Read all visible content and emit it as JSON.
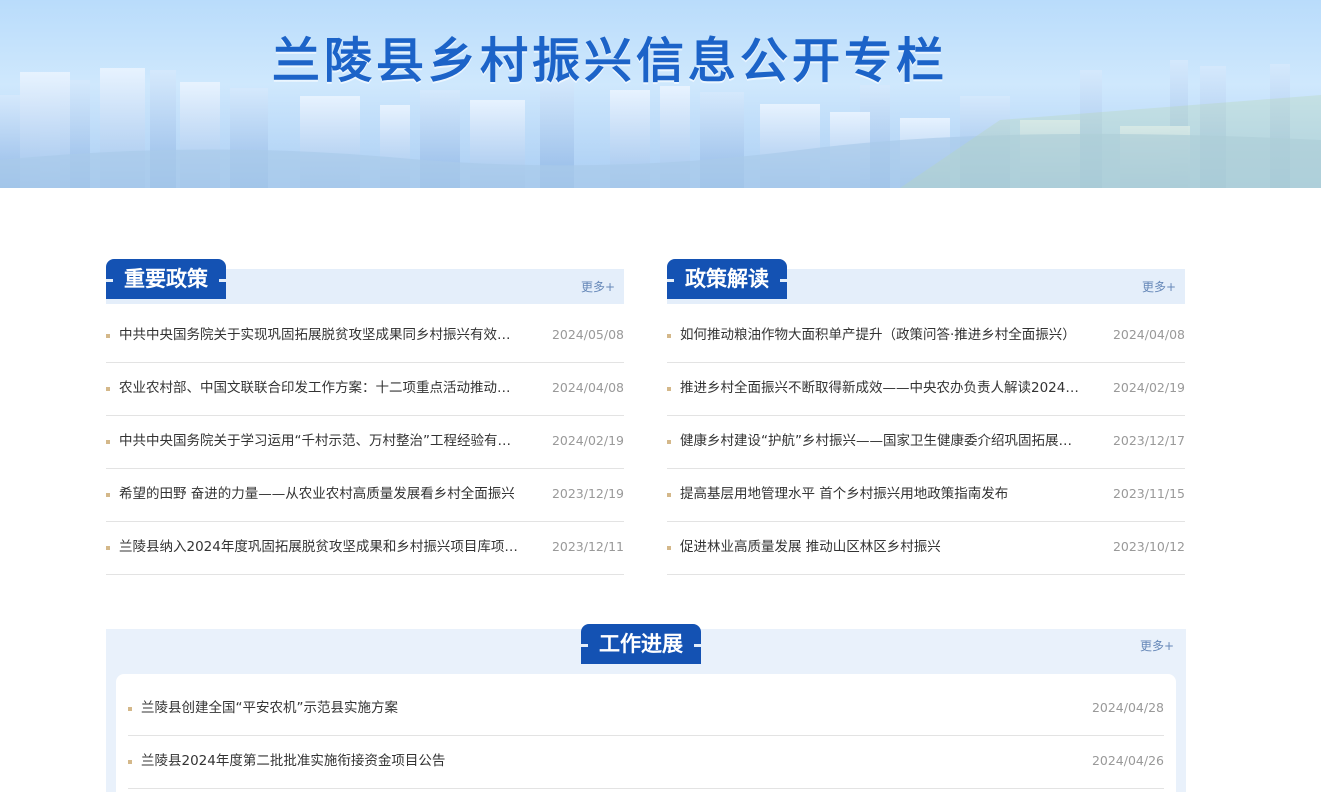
{
  "banner": {
    "title": "兰陵县乡村振兴信息公开专栏"
  },
  "colors": {
    "accent": "#1452b3",
    "title_blue": "#1c63c8",
    "panel_bg": "#e4eefa",
    "bullet": "#d4b88a",
    "date": "#999999"
  },
  "policies": {
    "tab_label": "重要政策",
    "more_label": "更多+",
    "items": [
      {
        "title": "中共中央国务院关于实现巩固拓展脱贫攻坚成果同乡村振兴有效…",
        "date": "2024/05/08"
      },
      {
        "title": "农业农村部、中国文联联合印发工作方案：十二项重点活动推动…",
        "date": "2024/04/08"
      },
      {
        "title": "中共中央国务院关于学习运用“千村示范、万村整治”工程经验有…",
        "date": "2024/02/19"
      },
      {
        "title": "希望的田野 奋进的力量——从农业农村高质量发展看乡村全面振兴",
        "date": "2023/12/19"
      },
      {
        "title": "兰陵县纳入2024年度巩固拓展脱贫攻坚成果和乡村振兴项目库项…",
        "date": "2023/12/11"
      }
    ]
  },
  "interpretation": {
    "tab_label": "政策解读",
    "more_label": "更多+",
    "items": [
      {
        "title": "如何推动粮油作物大面积单产提升（政策问答·推进乡村全面振兴）",
        "date": "2024/04/08"
      },
      {
        "title": "推进乡村全面振兴不断取得新成效——中央农办负责人解读2024…",
        "date": "2024/02/19"
      },
      {
        "title": "健康乡村建设“护航”乡村振兴——国家卫生健康委介绍巩固拓展…",
        "date": "2023/12/17"
      },
      {
        "title": "提高基层用地管理水平 首个乡村振兴用地政策指南发布",
        "date": "2023/11/15"
      },
      {
        "title": "促进林业高质量发展 推动山区林区乡村振兴",
        "date": "2023/10/12"
      }
    ]
  },
  "work": {
    "tab_label": "工作进展",
    "more_label": "更多+",
    "items": [
      {
        "title": "兰陵县创建全国“平安农机”示范县实施方案",
        "date": "2024/04/28"
      },
      {
        "title": "兰陵县2024年度第二批批准实施衔接资金项目公告",
        "date": "2024/04/26"
      }
    ]
  }
}
